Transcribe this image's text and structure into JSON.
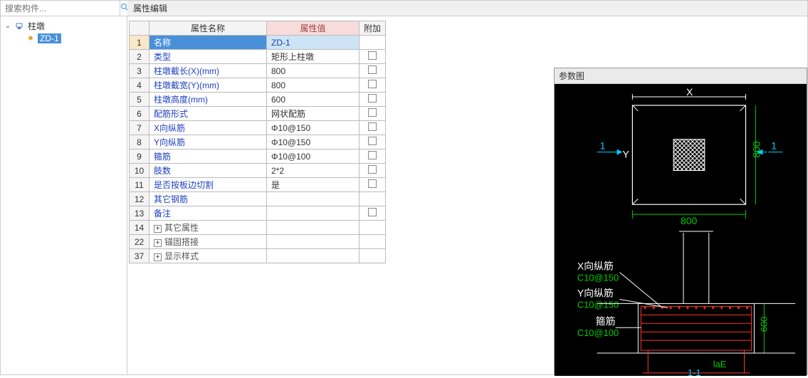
{
  "search": {
    "placeholder": "搜索构件..."
  },
  "tree": {
    "root": {
      "label": "柱墩"
    },
    "child": {
      "label": "ZD-1"
    }
  },
  "editor": {
    "title": "属性编辑"
  },
  "grid": {
    "headers": {
      "name": "属性名称",
      "value": "属性值",
      "addon": "附加"
    },
    "rows": [
      {
        "n": "1",
        "name": "名称",
        "value": "ZD-1",
        "chk": false,
        "sel": true
      },
      {
        "n": "2",
        "name": "类型",
        "value": "矩形上柱墩",
        "chk": true
      },
      {
        "n": "3",
        "name": "柱墩截长(X)(mm)",
        "value": "800",
        "chk": true
      },
      {
        "n": "4",
        "name": "柱墩截宽(Y)(mm)",
        "value": "800",
        "chk": true
      },
      {
        "n": "5",
        "name": "柱墩高度(mm)",
        "value": "600",
        "chk": true
      },
      {
        "n": "6",
        "name": "配筋形式",
        "value": "网状配筋",
        "chk": true
      },
      {
        "n": "7",
        "name": "X向纵筋",
        "value": "Φ10@150",
        "chk": true
      },
      {
        "n": "8",
        "name": "Y向纵筋",
        "value": "Φ10@150",
        "chk": true
      },
      {
        "n": "9",
        "name": "箍筋",
        "value": "Φ10@100",
        "chk": true
      },
      {
        "n": "10",
        "name": "肢数",
        "value": "2*2",
        "chk": true
      },
      {
        "n": "11",
        "name": "是否按板边切割",
        "value": "是",
        "chk": true
      },
      {
        "n": "12",
        "name": "其它钢筋",
        "value": "",
        "chk": false
      },
      {
        "n": "13",
        "name": "备注",
        "value": "",
        "chk": true
      },
      {
        "n": "14",
        "name": "其它属性",
        "value": "",
        "group": true,
        "expand": "+"
      },
      {
        "n": "22",
        "name": "锚固搭接",
        "value": "",
        "group": true,
        "expand": "+"
      },
      {
        "n": "37",
        "name": "显示样式",
        "value": "",
        "group": true,
        "expand": "+"
      }
    ]
  },
  "diagram": {
    "title": "参数图",
    "labels": {
      "x": "X",
      "y": "Y",
      "one": "1",
      "width": "800",
      "height": "800",
      "xbar": "X向纵筋",
      "xbar_v": "C10@150",
      "ybar": "Y向纵筋",
      "ybar_v": "C10@150",
      "stirrup": "箍筋",
      "stirrup_v": "C10@100",
      "h": "600",
      "laE": "laE",
      "sec": "1-1"
    }
  }
}
